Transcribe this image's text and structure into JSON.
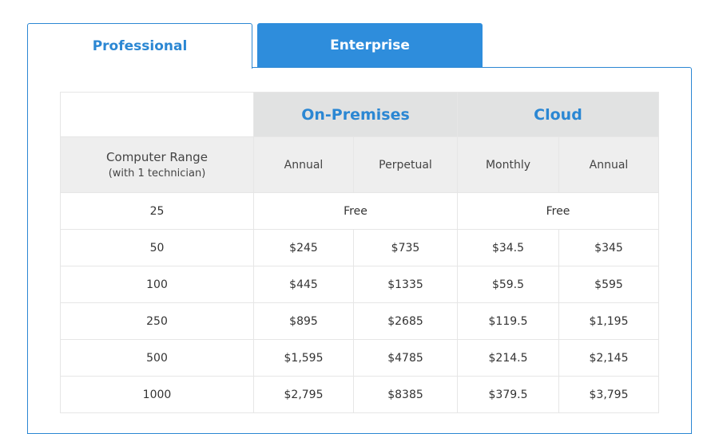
{
  "tabs": [
    {
      "label": "Professional",
      "active": true
    },
    {
      "label": "Enterprise",
      "active": false
    }
  ],
  "table": {
    "groups": {
      "on_premises": "On-Premises",
      "cloud": "Cloud"
    },
    "range_header": {
      "main": "Computer Range",
      "sub": "(with 1 technician)"
    },
    "columns": {
      "onprem_annual": "Annual",
      "onprem_perpetual": "Perpetual",
      "cloud_monthly": "Monthly",
      "cloud_annual": "Annual"
    },
    "free_row": {
      "range": "25",
      "onprem": "Free",
      "cloud": "Free"
    },
    "rows": [
      {
        "range": "50",
        "onprem_annual": "$245",
        "onprem_perpetual": "$735",
        "cloud_monthly": "$34.5",
        "cloud_annual": "$345"
      },
      {
        "range": "100",
        "onprem_annual": "$445",
        "onprem_perpetual": "$1335",
        "cloud_monthly": "$59.5",
        "cloud_annual": "$595"
      },
      {
        "range": "250",
        "onprem_annual": "$895",
        "onprem_perpetual": "$2685",
        "cloud_monthly": "$119.5",
        "cloud_annual": "$1,195"
      },
      {
        "range": "500",
        "onprem_annual": "$1,595",
        "onprem_perpetual": "$4785",
        "cloud_monthly": "$214.5",
        "cloud_annual": "$2,145"
      },
      {
        "range": "1000",
        "onprem_annual": "$2,795",
        "onprem_perpetual": "$8385",
        "cloud_monthly": "$379.5",
        "cloud_annual": "$3,795"
      }
    ]
  },
  "colors": {
    "accent": "#2b87d3",
    "tab_inactive_bg": "#2e8ddc",
    "header_bg": "#e1e2e2",
    "subheader_bg": "#eeeeee"
  }
}
